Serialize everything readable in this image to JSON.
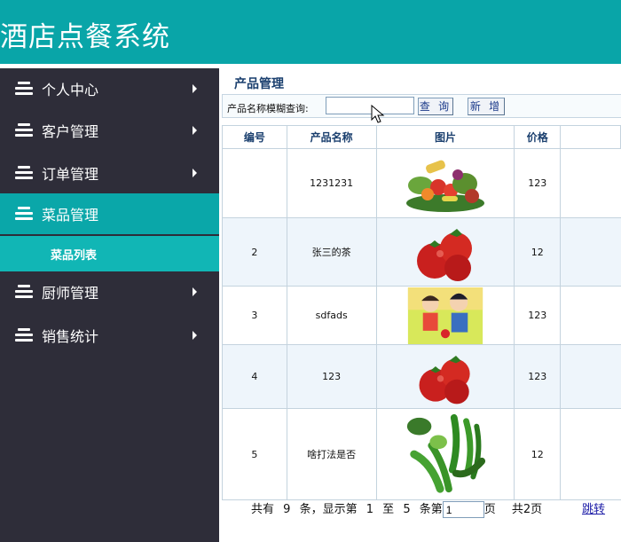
{
  "app": {
    "title": "酒店点餐系统"
  },
  "sidebar": {
    "items": [
      {
        "label": "个人中心",
        "active": false
      },
      {
        "label": "客户管理",
        "active": false
      },
      {
        "label": "订单管理",
        "active": false
      },
      {
        "label": "菜品管理",
        "active": true
      },
      {
        "label": "厨师管理",
        "active": false
      },
      {
        "label": "销售统计",
        "active": false
      }
    ],
    "submenu": {
      "label": "菜品列表"
    }
  },
  "main": {
    "page_title": "产品管理",
    "search": {
      "label": "产品名称模糊查询:",
      "value": "",
      "placeholder": ""
    },
    "buttons": {
      "query": "查 询",
      "add": "新 增"
    },
    "table": {
      "columns": [
        "编号",
        "产品名称",
        "图片",
        "价格",
        ""
      ],
      "rows": [
        {
          "id": "",
          "name": "1231231",
          "image": "vegetable-assortment-image",
          "price": "123"
        },
        {
          "id": "2",
          "name": "张三的茶",
          "image": "tomatoes-image",
          "price": "12"
        },
        {
          "id": "3",
          "name": "sdfads",
          "image": "cartoon-children-image",
          "price": "123"
        },
        {
          "id": "4",
          "name": "123",
          "image": "tomatoes-image",
          "price": "123"
        },
        {
          "id": "5",
          "name": "啥打法是否",
          "image": "green-peppers-image",
          "price": "12"
        }
      ]
    },
    "pager": {
      "total_prefix": "共有",
      "total": "9",
      "count_suffix": "条，显示第",
      "from": "1",
      "to_word": "至",
      "to": "5",
      "page_prefix": "条第",
      "page_value": "1",
      "page_suffix": "页",
      "total_pages": "共2页",
      "jump": "跳转"
    }
  },
  "colors": {
    "header": "#09a5a8",
    "sidebar": "#2e2d39",
    "active": "#0aa7a9",
    "submenu": "#11b6b5"
  }
}
